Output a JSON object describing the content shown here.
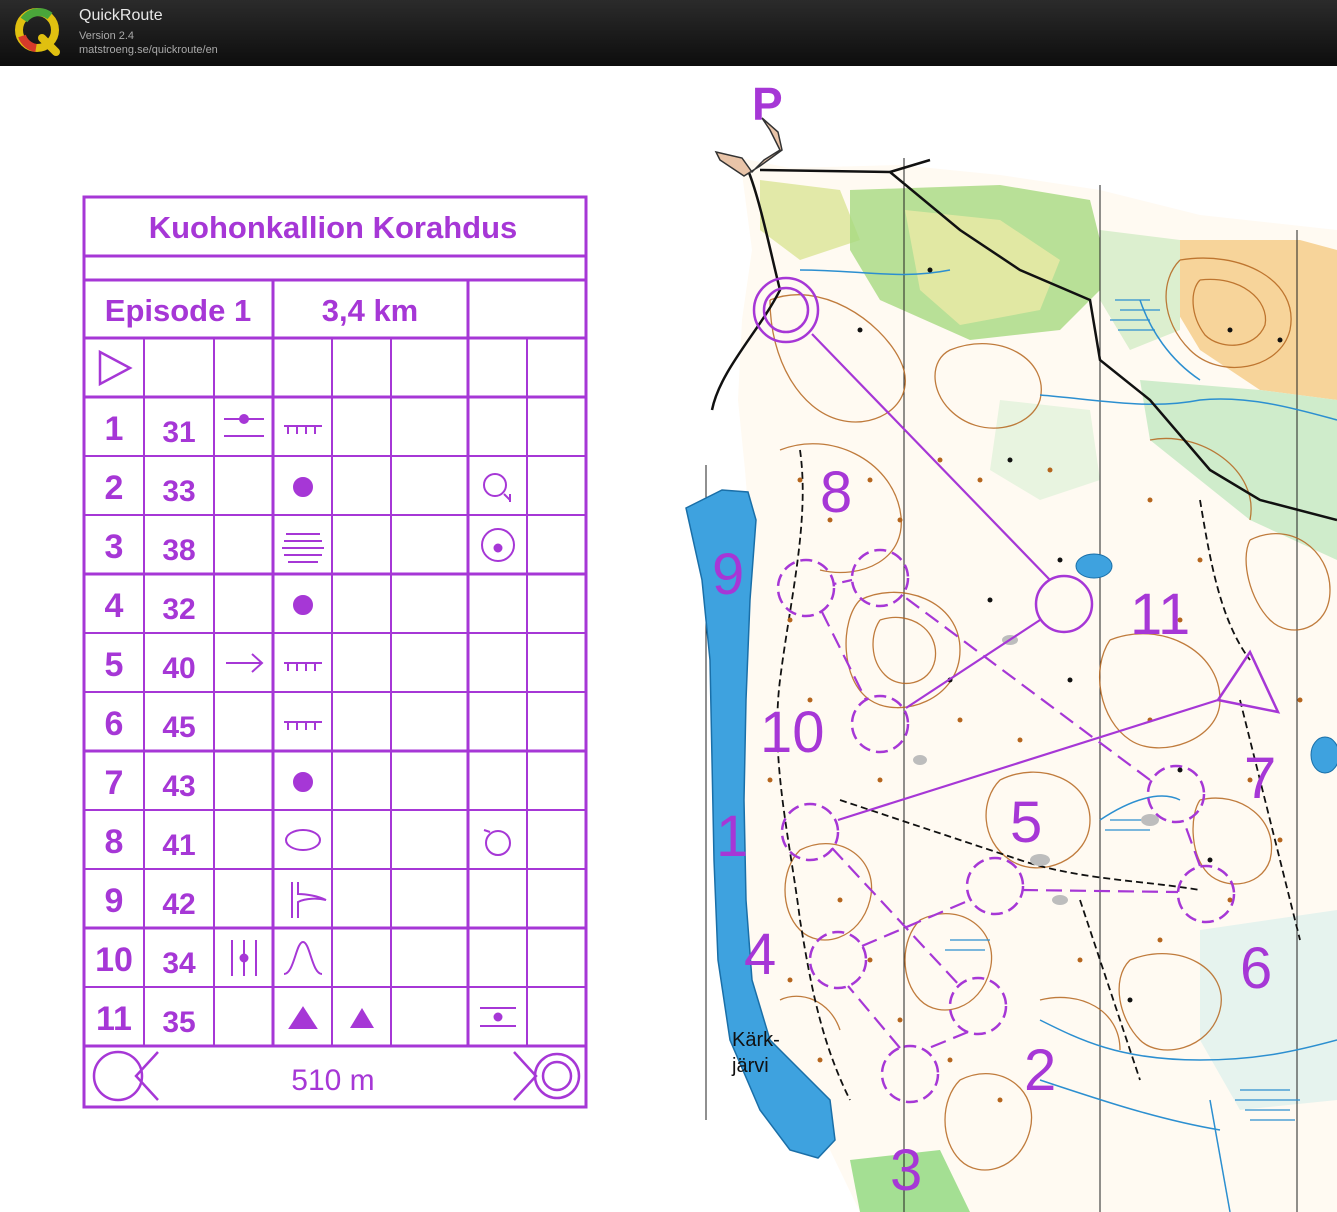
{
  "app": {
    "name": "QuickRoute",
    "version": "Version 2.4",
    "url": "matstroeng.se/quickroute/en"
  },
  "colors": {
    "purple": "#a637d6",
    "water": "#3ea2df",
    "contour": "#b5651d",
    "green": "#7dd36b",
    "yellow": "#f5c77e"
  },
  "description_sheet": {
    "title": "Kuohonkallion Korahdus",
    "episode": "Episode 1",
    "distance": "3,4 km",
    "controls": [
      {
        "num": "1",
        "code": "31",
        "c_symbol": "line-crossing",
        "d_symbol": "earth-wall",
        "g_symbol": ""
      },
      {
        "num": "2",
        "code": "33",
        "c_symbol": "",
        "d_symbol": "boulder",
        "g_symbol": "circle-foot"
      },
      {
        "num": "3",
        "code": "38",
        "c_symbol": "",
        "d_symbol": "boulder-field",
        "g_symbol": "circle-dot"
      },
      {
        "num": "4",
        "code": "32",
        "c_symbol": "",
        "d_symbol": "boulder",
        "g_symbol": ""
      },
      {
        "num": "5",
        "code": "40",
        "c_symbol": "arrow-right",
        "d_symbol": "earth-wall",
        "g_symbol": ""
      },
      {
        "num": "6",
        "code": "45",
        "c_symbol": "",
        "d_symbol": "earth-wall",
        "g_symbol": ""
      },
      {
        "num": "7",
        "code": "43",
        "c_symbol": "",
        "d_symbol": "boulder",
        "g_symbol": ""
      },
      {
        "num": "8",
        "code": "41",
        "c_symbol": "",
        "d_symbol": "oval",
        "g_symbol": "circle-top"
      },
      {
        "num": "9",
        "code": "42",
        "c_symbol": "",
        "d_symbol": "re-entrant",
        "g_symbol": ""
      },
      {
        "num": "10",
        "code": "34",
        "c_symbol": "vertical-lines",
        "d_symbol": "knoll",
        "g_symbol": ""
      },
      {
        "num": "11",
        "code": "35",
        "c_symbol": "",
        "d_symbol": "triangle",
        "e_symbol": "triangle",
        "g_symbol": "line-dot"
      }
    ],
    "finish_distance": "510 m"
  },
  "map": {
    "parking_label": "P",
    "lake_label_line1": "Kärk-",
    "lake_label_line2": "järvi",
    "control_numbers": [
      "1",
      "2",
      "3",
      "4",
      "5",
      "6",
      "7",
      "8",
      "9",
      "10",
      "11"
    ]
  }
}
